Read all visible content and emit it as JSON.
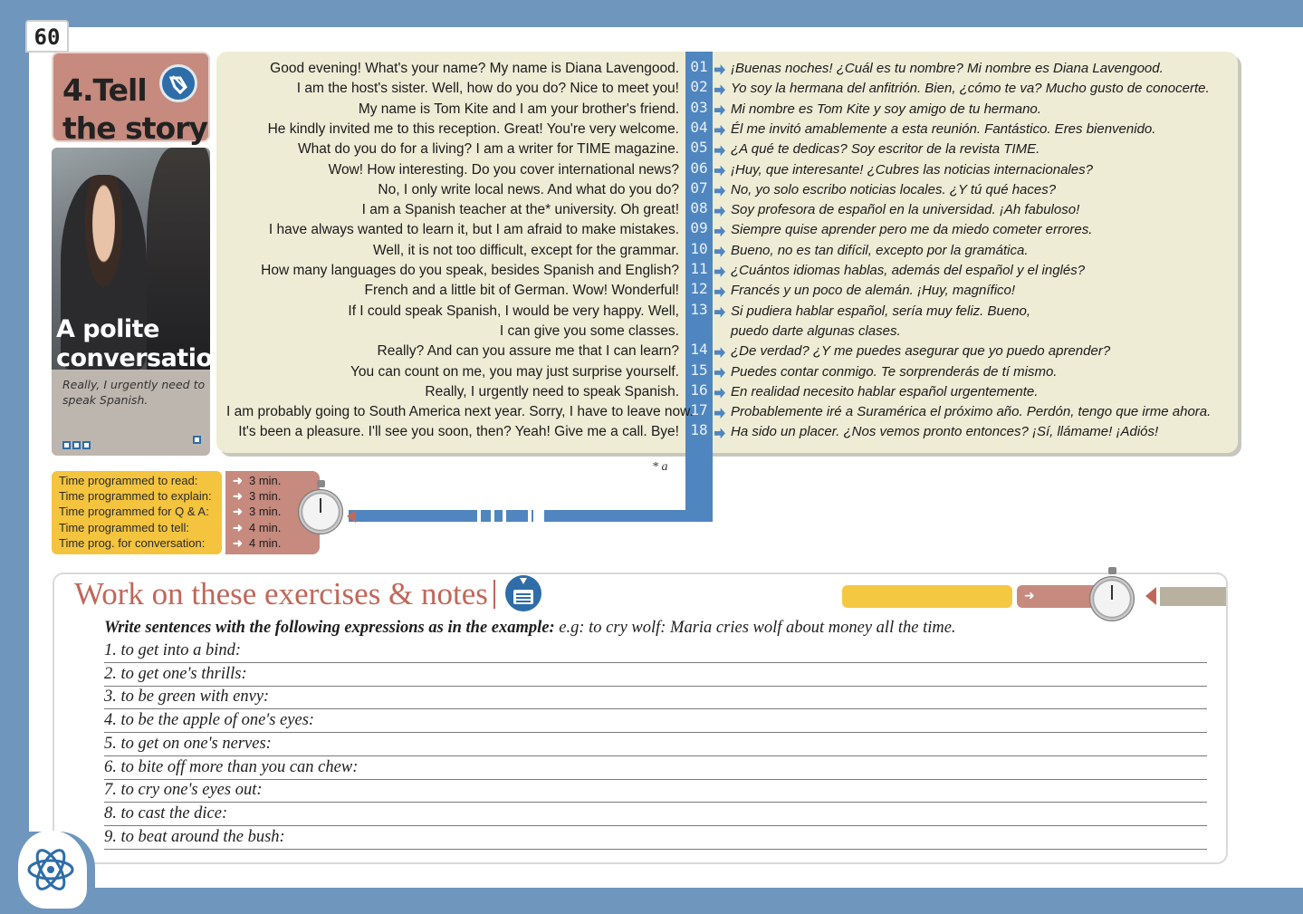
{
  "page_number": "60",
  "section": {
    "title_line1": "4.Tell",
    "title_line2": "the story",
    "photo_title_line1": "A polite",
    "photo_title_line2": "conversation",
    "photo_caption": "Really, I urgently need to speak Spanish."
  },
  "dialogue": [
    {
      "num": "01",
      "en": "Good evening! What's your name? My name is Diana Lavengood.",
      "es": "¡Buenas noches! ¿Cuál es tu nombre? Mi nombre es Diana Lavengood."
    },
    {
      "num": "02",
      "en": "I am the host's sister. Well, how do you do? Nice to meet you!",
      "es": "Yo soy la hermana del anfitrión. Bien, ¿cómo te va?  Mucho gusto de conocerte."
    },
    {
      "num": "03",
      "en": "My name is Tom Kite and I am your brother's friend.",
      "es": "Mi nombre es Tom Kite y soy amigo de tu hermano."
    },
    {
      "num": "04",
      "en": "He kindly invited me to this reception. Great! You're very welcome.",
      "es": "Él me invitó amablemente a esta reunión. Fantástico. Eres bienvenido."
    },
    {
      "num": "05",
      "en": "What do you do for a living? I am a writer for TIME magazine.",
      "es": "¿A qué te dedicas? Soy escritor de la revista TIME."
    },
    {
      "num": "06",
      "en": "Wow! How interesting. Do you cover international news?",
      "es": "¡Huy, que interesante! ¿Cubres las noticias internacionales?"
    },
    {
      "num": "07",
      "en": "No, I only write local news. And what do you do?",
      "es": "No, yo solo escribo noticias locales. ¿Y tú qué haces?"
    },
    {
      "num": "08",
      "en": "I am a Spanish teacher at the* university. Oh great!",
      "es": "Soy profesora de español en la universidad. ¡Ah fabuloso!"
    },
    {
      "num": "09",
      "en": "I have always wanted to learn it, but I am afraid to make mistakes.",
      "es": "Siempre quise aprender pero me da miedo cometer errores."
    },
    {
      "num": "10",
      "en": "Well, it is not too difficult, except for the grammar.",
      "es": "Bueno, no es tan difícil, excepto por la gramática."
    },
    {
      "num": "11",
      "en": "How many languages do you speak, besides Spanish and English?",
      "es": "¿Cuántos idiomas hablas, además del español y el inglés?"
    },
    {
      "num": "12",
      "en": "French and a little bit of German. Wow! Wonderful!",
      "es": "Francés y un poco de alemán. ¡Huy, magnífico!"
    },
    {
      "num": "13",
      "en": "If I could speak Spanish, I would be very happy. Well,",
      "es": "Si pudiera hablar español, sería muy feliz. Bueno,"
    },
    {
      "num": "",
      "en": "I can give you some classes.",
      "es": "puedo darte algunas clases."
    },
    {
      "num": "14",
      "en": "Really? And can you assure me that I can learn?",
      "es": "¿De verdad? ¿Y me puedes asegurar que yo puedo aprender?"
    },
    {
      "num": "15",
      "en": "You can count on me, you may just surprise yourself.",
      "es": "Puedes contar conmigo. Te sorprenderás de tí mismo."
    },
    {
      "num": "16",
      "en": "Really, I urgently need to speak Spanish.",
      "es": "En realidad necesito hablar español urgentemente."
    },
    {
      "num": "17",
      "en": "I am probably going to South America next year. Sorry, I have to leave now.",
      "es": "Probablemente iré a Suramérica el próximo año. Perdón, tengo que irme ahora."
    },
    {
      "num": "18",
      "en": "It's been a pleasure. I'll see you soon, then? Yeah! Give me a call. Bye!",
      "es": "Ha sido un placer. ¿Nos vemos pronto entonces? ¡Sí, llámame! ¡Adiós!"
    }
  ],
  "footnote": "* a",
  "timing": [
    {
      "label": "Time programmed to read:",
      "value": "3 min."
    },
    {
      "label": "Time programmed to explain:",
      "value": "3 min."
    },
    {
      "label": "Time programmed for Q & A:",
      "value": "3 min."
    },
    {
      "label": "Time programmed to tell:",
      "value": "4 min."
    },
    {
      "label": "Time prog. for conversation:",
      "value": "4 min."
    }
  ],
  "exercises": {
    "title": "Work on these exercises & notes",
    "instruction_bold": "Write sentences with the following expressions as in the example:",
    "instruction_rest": " e.g:  to cry wolf:  Maria cries wolf about money all the time.",
    "items": [
      "1. to get into a bind:",
      "2. to get one's thrills:",
      "3. to be green with envy:",
      "4. to be the apple of one's eyes:",
      "5. to get on one's nerves:",
      "6. to bite off more than you can chew:",
      "7. to cry one's eyes out:",
      "8. to cast the dice:",
      "9. to beat around the bush:"
    ]
  },
  "colors": {
    "frame_blue": "#6f96bd",
    "accent_blue": "#4f86c0",
    "rose": "#c68a7e",
    "yellow": "#f4c43e",
    "cream": "#efecd6",
    "title_red": "#c0675a"
  },
  "icons": [
    "audio-icon",
    "download-notes-icon",
    "stopwatch-icon",
    "atom-head-logo"
  ]
}
